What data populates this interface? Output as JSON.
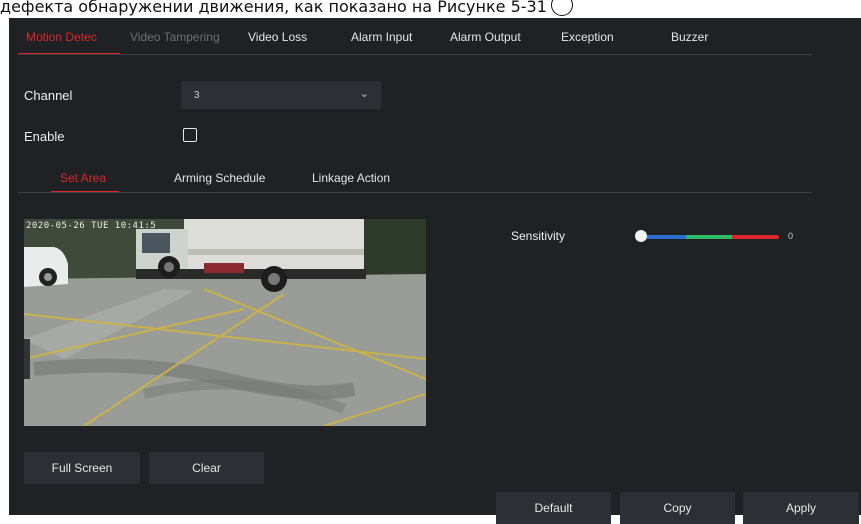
{
  "caption": {
    "text": "дефекта обнаружении движения, как показано на Рисунке 5-31"
  },
  "tabs": [
    {
      "label": "Motion Detec",
      "state": "active"
    },
    {
      "label": "Video Tampering",
      "state": "disabled"
    },
    {
      "label": "Video Loss",
      "state": "normal"
    },
    {
      "label": "Alarm Input",
      "state": "normal"
    },
    {
      "label": "Alarm Output",
      "state": "normal"
    },
    {
      "label": "Exception",
      "state": "normal"
    },
    {
      "label": "Buzzer",
      "state": "normal"
    }
  ],
  "form": {
    "channel_label": "Channel",
    "channel_value": "3",
    "enable_label": "Enable",
    "enable_checked": false
  },
  "subtabs": [
    {
      "label": "Set Area",
      "state": "active"
    },
    {
      "label": "Arming Schedule",
      "state": "normal"
    },
    {
      "label": "Linkage Action",
      "state": "normal"
    }
  ],
  "video": {
    "osd_text": "2020-05-26 TUE 10:41:5"
  },
  "sensitivity": {
    "label": "Sensitivity",
    "value": "0",
    "level": 0
  },
  "buttons": {
    "full_screen": "Full Screen",
    "clear": "Clear",
    "default": "Default",
    "copy": "Copy",
    "apply": "Apply"
  },
  "colors": {
    "accent": "#d9282b",
    "panel_bg": "#1f2125",
    "control_bg": "#2c2f34",
    "slider_blue": "#2d6fd1",
    "slider_green": "#2fba6a",
    "slider_red": "#d9282b"
  }
}
